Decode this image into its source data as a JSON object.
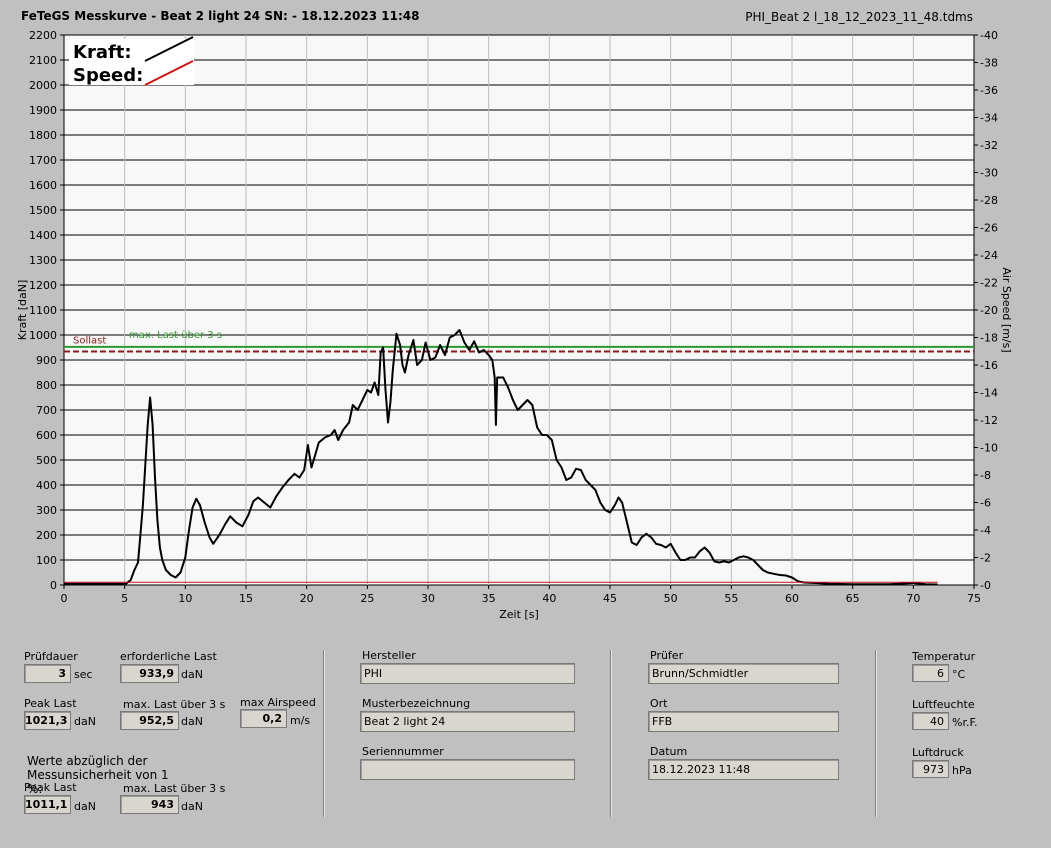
{
  "header": {
    "title": "FeTeGS Messkurve - Beat 2 light 24  SN:  - 18.12.2023 11:48",
    "filename": "PHI_Beat 2 l_18_12_2023_11_48.tdms"
  },
  "chart_data": {
    "type": "line",
    "xlabel": "Zeit [s]",
    "ylabel": "Kraft [daN]",
    "y2label": "Air Speed [m/s]",
    "xlim": [
      0,
      75
    ],
    "ylim": [
      0,
      2200
    ],
    "y2lim": [
      0,
      40
    ],
    "x_ticks": [
      0,
      5,
      10,
      15,
      20,
      25,
      30,
      35,
      40,
      45,
      50,
      55,
      60,
      65,
      70,
      75
    ],
    "y_ticks": [
      0,
      100,
      200,
      300,
      400,
      500,
      600,
      700,
      800,
      900,
      1000,
      1100,
      1200,
      1300,
      1400,
      1500,
      1600,
      1700,
      1800,
      1900,
      2000,
      2100,
      2200
    ],
    "y2_ticks": [
      0,
      2,
      4,
      6,
      8,
      10,
      12,
      14,
      16,
      18,
      20,
      22,
      24,
      26,
      28,
      30,
      32,
      34,
      36,
      38,
      40
    ],
    "grid": true,
    "legend": {
      "kraft_label": "Kraft:",
      "speed_label": "Speed:",
      "placement": "top-left"
    },
    "reference_lines": [
      {
        "name": "Sollast",
        "value": 933.9,
        "color": "#8b1a1a",
        "style": "dashed"
      },
      {
        "name": "max. Last über  3 s",
        "value": 952.5,
        "color": "#2e9a2e",
        "style": "solid"
      }
    ],
    "series": [
      {
        "name": "Kraft",
        "color": "#000000",
        "points": [
          [
            0,
            5
          ],
          [
            5.1,
            5
          ],
          [
            5.5,
            20
          ],
          [
            5.8,
            60
          ],
          [
            6.1,
            90
          ],
          [
            6.3,
            200
          ],
          [
            6.5,
            320
          ],
          [
            6.7,
            480
          ],
          [
            6.9,
            640
          ],
          [
            7.1,
            750
          ],
          [
            7.3,
            640
          ],
          [
            7.5,
            430
          ],
          [
            7.7,
            260
          ],
          [
            7.9,
            150
          ],
          [
            8.1,
            100
          ],
          [
            8.4,
            60
          ],
          [
            8.8,
            40
          ],
          [
            9.2,
            30
          ],
          [
            9.6,
            50
          ],
          [
            10,
            110
          ],
          [
            10.3,
            220
          ],
          [
            10.6,
            310
          ],
          [
            10.9,
            345
          ],
          [
            11.2,
            320
          ],
          [
            11.6,
            250
          ],
          [
            12,
            190
          ],
          [
            12.3,
            165
          ],
          [
            12.8,
            200
          ],
          [
            13.3,
            245
          ],
          [
            13.7,
            275
          ],
          [
            14.2,
            250
          ],
          [
            14.7,
            235
          ],
          [
            15.2,
            280
          ],
          [
            15.6,
            335
          ],
          [
            16,
            350
          ],
          [
            16.5,
            330
          ],
          [
            17,
            310
          ],
          [
            17.5,
            355
          ],
          [
            18,
            390
          ],
          [
            18.5,
            420
          ],
          [
            19,
            445
          ],
          [
            19.4,
            430
          ],
          [
            19.8,
            460
          ],
          [
            20.1,
            560
          ],
          [
            20.4,
            470
          ],
          [
            20.7,
            520
          ],
          [
            21,
            570
          ],
          [
            21.5,
            590
          ],
          [
            22,
            600
          ],
          [
            22.3,
            620
          ],
          [
            22.6,
            580
          ],
          [
            23,
            620
          ],
          [
            23.5,
            650
          ],
          [
            23.8,
            720
          ],
          [
            24.2,
            700
          ],
          [
            24.6,
            740
          ],
          [
            25,
            780
          ],
          [
            25.3,
            770
          ],
          [
            25.6,
            810
          ],
          [
            25.9,
            760
          ],
          [
            26.1,
            930
          ],
          [
            26.3,
            950
          ],
          [
            26.5,
            780
          ],
          [
            26.7,
            650
          ],
          [
            26.9,
            730
          ],
          [
            27.1,
            860
          ],
          [
            27.4,
            1005
          ],
          [
            27.7,
            960
          ],
          [
            27.9,
            880
          ],
          [
            28.1,
            850
          ],
          [
            28.4,
            920
          ],
          [
            28.8,
            980
          ],
          [
            29.1,
            880
          ],
          [
            29.5,
            900
          ],
          [
            29.8,
            970
          ],
          [
            30.2,
            900
          ],
          [
            30.6,
            910
          ],
          [
            31,
            960
          ],
          [
            31.4,
            920
          ],
          [
            31.8,
            990
          ],
          [
            32.2,
            1000
          ],
          [
            32.6,
            1020
          ],
          [
            33,
            970
          ],
          [
            33.4,
            940
          ],
          [
            33.8,
            975
          ],
          [
            34.2,
            930
          ],
          [
            34.6,
            940
          ],
          [
            35,
            920
          ],
          [
            35.3,
            900
          ],
          [
            35.5,
            830
          ],
          [
            35.6,
            640
          ],
          [
            35.7,
            830
          ],
          [
            36.2,
            830
          ],
          [
            36.6,
            790
          ],
          [
            37,
            740
          ],
          [
            37.4,
            700
          ],
          [
            37.8,
            720
          ],
          [
            38.2,
            740
          ],
          [
            38.6,
            720
          ],
          [
            39,
            630
          ],
          [
            39.4,
            600
          ],
          [
            39.8,
            600
          ],
          [
            40.2,
            580
          ],
          [
            40.6,
            500
          ],
          [
            41,
            470
          ],
          [
            41.4,
            420
          ],
          [
            41.8,
            430
          ],
          [
            42.2,
            465
          ],
          [
            42.6,
            460
          ],
          [
            43,
            420
          ],
          [
            43.4,
            400
          ],
          [
            43.8,
            380
          ],
          [
            44.2,
            330
          ],
          [
            44.6,
            300
          ],
          [
            45,
            290
          ],
          [
            45.4,
            320
          ],
          [
            45.7,
            350
          ],
          [
            46,
            330
          ],
          [
            46.4,
            250
          ],
          [
            46.8,
            170
          ],
          [
            47.2,
            160
          ],
          [
            47.6,
            190
          ],
          [
            48,
            205
          ],
          [
            48.4,
            190
          ],
          [
            48.8,
            165
          ],
          [
            49.2,
            160
          ],
          [
            49.6,
            150
          ],
          [
            50,
            165
          ],
          [
            50.4,
            130
          ],
          [
            50.8,
            100
          ],
          [
            51.2,
            100
          ],
          [
            51.6,
            110
          ],
          [
            52,
            110
          ],
          [
            52.4,
            135
          ],
          [
            52.8,
            150
          ],
          [
            53.2,
            130
          ],
          [
            53.6,
            95
          ],
          [
            54,
            90
          ],
          [
            54.4,
            95
          ],
          [
            54.8,
            90
          ],
          [
            55.2,
            100
          ],
          [
            55.6,
            110
          ],
          [
            56,
            115
          ],
          [
            56.4,
            110
          ],
          [
            56.8,
            100
          ],
          [
            57.2,
            80
          ],
          [
            57.6,
            60
          ],
          [
            58,
            50
          ],
          [
            58.5,
            45
          ],
          [
            59,
            40
          ],
          [
            59.5,
            38
          ],
          [
            60,
            30
          ],
          [
            60.5,
            15
          ],
          [
            61,
            10
          ],
          [
            62,
            8
          ],
          [
            63,
            5
          ],
          [
            65,
            3
          ],
          [
            68,
            3
          ],
          [
            70,
            8
          ],
          [
            71,
            3
          ],
          [
            72,
            2
          ]
        ]
      },
      {
        "name": "Speed",
        "color": "#d01010",
        "points": [
          [
            0,
            0.2
          ],
          [
            72,
            0.2
          ]
        ]
      }
    ]
  },
  "panel": {
    "pruefdauer": {
      "label": "Prüfdauer",
      "value": "3",
      "unit": "sec"
    },
    "erforderliche_last": {
      "label": "erforderliche Last",
      "value": "933,9",
      "unit": "daN"
    },
    "peak_last": {
      "label": "Peak Last",
      "value": "1021,3",
      "unit": "daN"
    },
    "max_last": {
      "label": "max. Last über  3 s",
      "value": "952,5",
      "unit": "daN"
    },
    "max_airspeed": {
      "label": "max Airspeed",
      "value": "0,2",
      "unit": "m/s"
    },
    "werte_label": "Werte abzüglich der Messunsicherheit von 1  %:",
    "peak_last2": {
      "label": "Peak Last",
      "value": "1011,1",
      "unit": "daN"
    },
    "max_last2": {
      "label": "max. Last über  3 s",
      "value": "943",
      "unit": "daN"
    },
    "hersteller": {
      "label": "Hersteller",
      "value": "PHI"
    },
    "musterbezeichnung": {
      "label": "Musterbezeichnung",
      "value": "Beat 2 light 24"
    },
    "seriennummer": {
      "label": "Seriennummer",
      "value": ""
    },
    "pruefer": {
      "label": "Prüfer",
      "value": "Brunn/Schmidtler"
    },
    "ort": {
      "label": "Ort",
      "value": "FFB"
    },
    "datum": {
      "label": "Datum",
      "value": "18.12.2023 11:48"
    },
    "temperatur": {
      "label": "Temperatur",
      "value": "6",
      "unit": "°C"
    },
    "luftfeuchte": {
      "label": "Luftfeuchte",
      "value": "40",
      "unit": "%r.F."
    },
    "luftdruck": {
      "label": "Luftdruck",
      "value": "973",
      "unit": "hPa"
    }
  }
}
